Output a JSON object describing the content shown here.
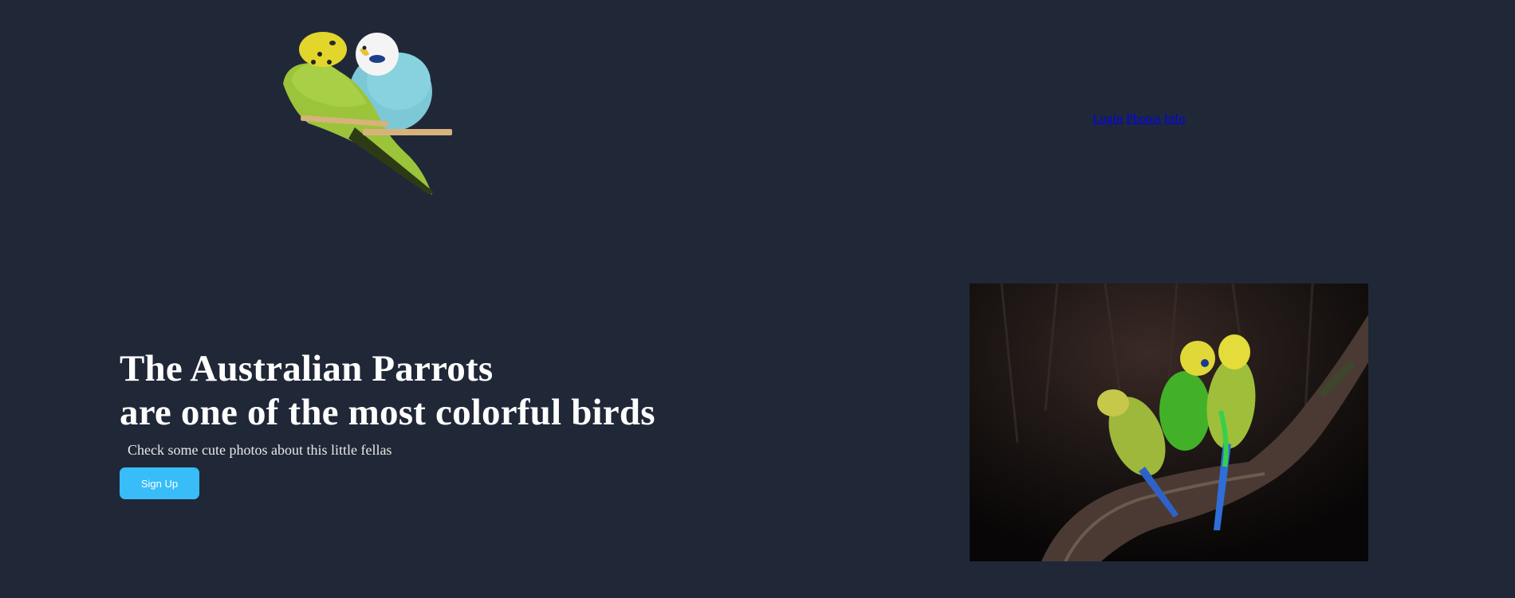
{
  "header": {
    "logo_icon": "two-budgies-icon",
    "nav": {
      "login": "Login",
      "photos": "Photos",
      "info": "Info"
    }
  },
  "hero": {
    "title_line1": "The Australian Parrots",
    "title_line2": "are one of the most colorful birds",
    "subtitle": "Check some cute photos about this little fellas",
    "signup_label": "Sign Up"
  },
  "photo": {
    "icon": "budgies-on-branch-photo"
  },
  "colors": {
    "background": "#202837",
    "button": "#38bdf8",
    "link": "#0000ee",
    "heading": "#ffffff"
  }
}
